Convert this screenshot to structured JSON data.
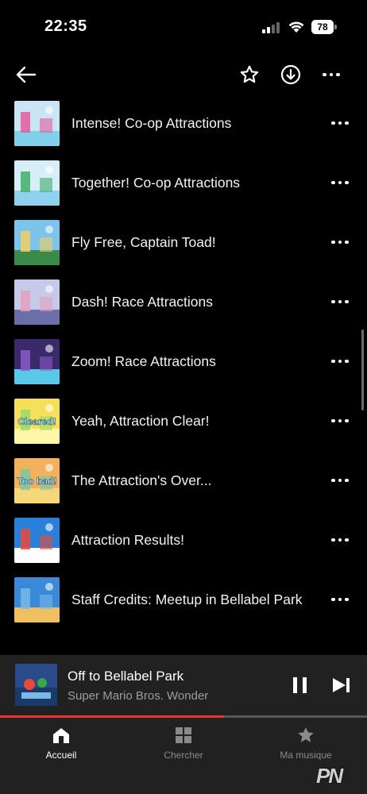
{
  "status_bar": {
    "time": "22:35",
    "battery": "78",
    "icons": [
      "cellular-signal-icon",
      "wifi-icon",
      "battery-icon"
    ]
  },
  "top_bar": {
    "icons": [
      "back-arrow-icon",
      "star-outline-icon",
      "download-circle-icon",
      "more-horizontal-icon"
    ]
  },
  "tracks": [
    {
      "title": "Intense! Co-op Attractions",
      "thumb_colors": [
        "#c9e4f5",
        "#e85b9a",
        "#7fd0e8"
      ]
    },
    {
      "title": "Together! Co-op Attractions",
      "thumb_colors": [
        "#d6eef8",
        "#3fae6a",
        "#8fd1ef"
      ]
    },
    {
      "title": "Fly Free, Captain Toad!",
      "thumb_colors": [
        "#7cc4ec",
        "#f0d060",
        "#3a8a4a"
      ]
    },
    {
      "title": "Dash! Race Attractions",
      "thumb_colors": [
        "#c7c9e8",
        "#e5a0c0",
        "#6b6fa8"
      ]
    },
    {
      "title": "Zoom! Race Attractions",
      "thumb_colors": [
        "#3a2a6a",
        "#8a5ac8",
        "#5ac8e8"
      ]
    },
    {
      "title": "Yeah, Attraction Clear!",
      "thumb_colors": [
        "#f6e05a",
        "#9fd86a",
        "#fff6a8"
      ],
      "thumb_text": "Cleared!"
    },
    {
      "title": "The Attraction's Over...",
      "thumb_colors": [
        "#f2b15a",
        "#7cc8a8",
        "#f6d87a"
      ],
      "thumb_text": "Too bad!"
    },
    {
      "title": "Attraction Results!",
      "thumb_colors": [
        "#2a7fd8",
        "#e84a3a",
        "#ffffff"
      ]
    },
    {
      "title": "Staff Credits: Meetup in Bellabel Park",
      "thumb_colors": [
        "#3a8ad8",
        "#7ab8e8",
        "#f0c060"
      ]
    }
  ],
  "mini_player": {
    "title": "Off to Bellabel Park",
    "artist": "Super Mario Bros. Wonder",
    "progress": 0.61,
    "icons": [
      "pause-icon",
      "skip-next-icon"
    ]
  },
  "bottom_nav": {
    "items": [
      {
        "label": "Accueil",
        "icon": "home-icon",
        "active": true
      },
      {
        "label": "Chercher",
        "icon": "grid-icon",
        "active": false
      },
      {
        "label": "Ma musique",
        "icon": "star-filled-icon",
        "active": false
      }
    ]
  },
  "watermark": "PN",
  "colors": {
    "background": "#000000",
    "player_bg": "#212121",
    "progress": "#e33333",
    "muted_text": "#9c9c9c"
  }
}
